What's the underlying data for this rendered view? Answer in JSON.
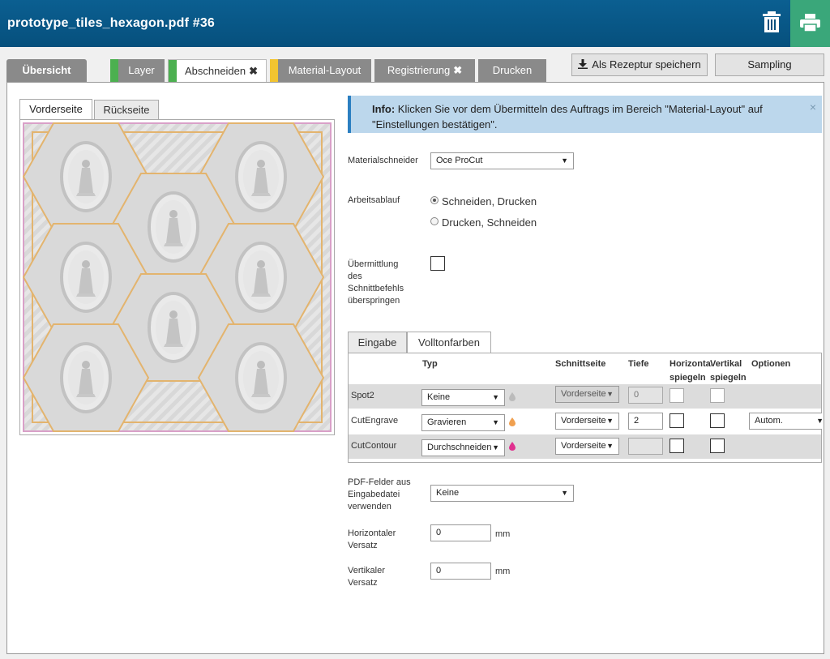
{
  "header": {
    "title": "prototype_tiles_hexagon.pdf #36"
  },
  "tabs": {
    "overview": "Übersicht",
    "layer": "Layer",
    "cut": "Abschneiden",
    "material_layout": "Material-Layout",
    "registration": "Registrierung",
    "print": "Drucken",
    "close_symbol": "✖"
  },
  "buttons": {
    "save_recipe": "Als Rezeptur speichern",
    "sampling": "Sampling"
  },
  "preview": {
    "front": "Vorderseite",
    "back": "Rückseite"
  },
  "info": {
    "label": "Info:",
    "text": "Klicken Sie vor dem Übermitteln des Auftrags im Bereich \"Material-Layout\" auf",
    "text2": "\"Einstellungen bestätigen\".",
    "close": "×"
  },
  "form": {
    "cutter_label": "Materialschneider",
    "cutter_value": "Oce ProCut",
    "workflow_label": "Arbeitsablauf",
    "workflow_options": [
      "Schneiden, Drucken",
      "Drucken, Schneiden"
    ],
    "skip_label": [
      "Übermittlung",
      "des",
      "Schnittbefehls",
      "überspringen"
    ],
    "pdf_fields_label": [
      "PDF-Felder aus",
      "Eingabedatei",
      "verwenden"
    ],
    "pdf_fields_value": "Keine",
    "h_offset_label": [
      "Horizontaler",
      "Versatz"
    ],
    "h_offset_value": "0",
    "v_offset_label": [
      "Vertikaler",
      "Versatz"
    ],
    "v_offset_value": "0",
    "unit": "mm"
  },
  "subtabs": {
    "input": "Eingabe",
    "spot": "Volltonfarben"
  },
  "table": {
    "headers": {
      "type": "Typ",
      "side": "Schnittseite",
      "depth": "Tiefe",
      "hmirror1": "Horizontal",
      "hmirror2": "spiegeln",
      "vmirror1": "Vertikal",
      "vmirror2": "spiegeln",
      "options": "Optionen"
    },
    "rows": [
      {
        "name": "Spot2",
        "type": "Keine",
        "side": "Vorderseite",
        "depth": "0",
        "options": ""
      },
      {
        "name": "CutEngrave",
        "type": "Gravieren",
        "side": "Vorderseite",
        "depth": "2",
        "options": "Autom."
      },
      {
        "name": "CutContour",
        "type": "Durchschneiden",
        "side": "Vorderseite",
        "depth": "",
        "options": ""
      }
    ]
  },
  "colors": {
    "header": "#06507d",
    "print_button": "#3aa77a",
    "layer_marker": "#4cb050",
    "cut_marker": "#4cb050",
    "material_marker": "#f2c431",
    "engrave_drop": "#f0a050",
    "contour_drop": "#e0308f"
  }
}
